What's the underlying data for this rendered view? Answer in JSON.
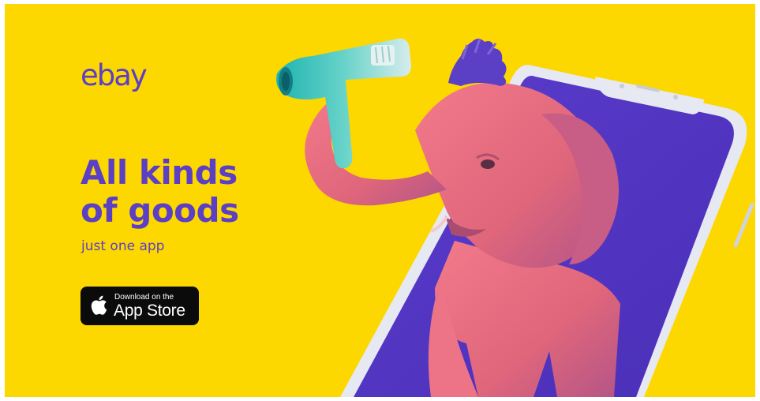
{
  "brand": {
    "logo_text": "ebay",
    "primary_color": "#5b3fc4",
    "background_color": "#fdd700"
  },
  "headline": {
    "line1": "All kinds",
    "line2": "of goods"
  },
  "subheadline": "just one app",
  "app_store_badge": {
    "small_text": "Download on the",
    "large_text": "App Store",
    "icon": "apple-icon"
  },
  "illustration": {
    "elements": [
      "elephant",
      "hair-dryer",
      "smartphone"
    ]
  }
}
